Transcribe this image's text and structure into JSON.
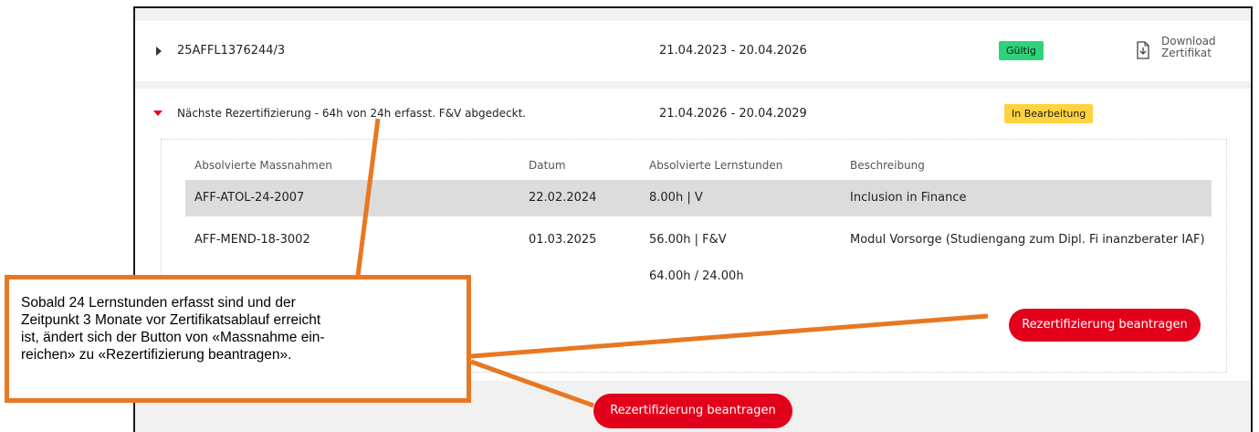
{
  "certificate": {
    "number": "25AFFL1376244/3",
    "period": "21.04.2023 - 20.04.2026",
    "status": "Gültig",
    "download_line1": "Download",
    "download_line2": "Zertifikat"
  },
  "recert": {
    "title": "Nächste Rezertifizierung - 64h von 24h erfasst. F&V abgedeckt.",
    "period": "21.04.2026 - 20.04.2029",
    "status": "In Bearbeitung"
  },
  "table": {
    "headers": [
      "Absolvierte Massnahmen",
      "Datum",
      "Absolvierte Lernstunden",
      "Beschreibung"
    ],
    "rows": [
      [
        "AFF-ATOL-24-2007",
        "22.02.2024",
        "8.00h | V",
        "Inclusion in Finance"
      ],
      [
        "AFF-MEND-18-3002",
        "01.03.2025",
        "56.00h | F&V",
        "Modul Vorsorge (Studiengang zum Dipl. Fi inanzberater IAF)"
      ]
    ],
    "total": "64.00h / 24.00h"
  },
  "buttons": {
    "recert_inner": "Rezertifizierung beantragen",
    "recert_outer": "Rezertifizierung beantragen"
  },
  "callout": {
    "line1": "Sobald 24 Lernstunden erfasst sind und der",
    "line2": "Zeitpunkt 3 Monate vor Zertifikatsablauf erreicht",
    "line3": "ist, ändert sich der Button von «Massnahme ein-",
    "line4": "reichen» zu «Rezertifizierung beantragen»."
  },
  "colors": {
    "brand_red": "#e2001a",
    "valid_green": "#2fd27a",
    "pending_yellow": "#ffd23f",
    "callout_orange": "#e87722"
  }
}
